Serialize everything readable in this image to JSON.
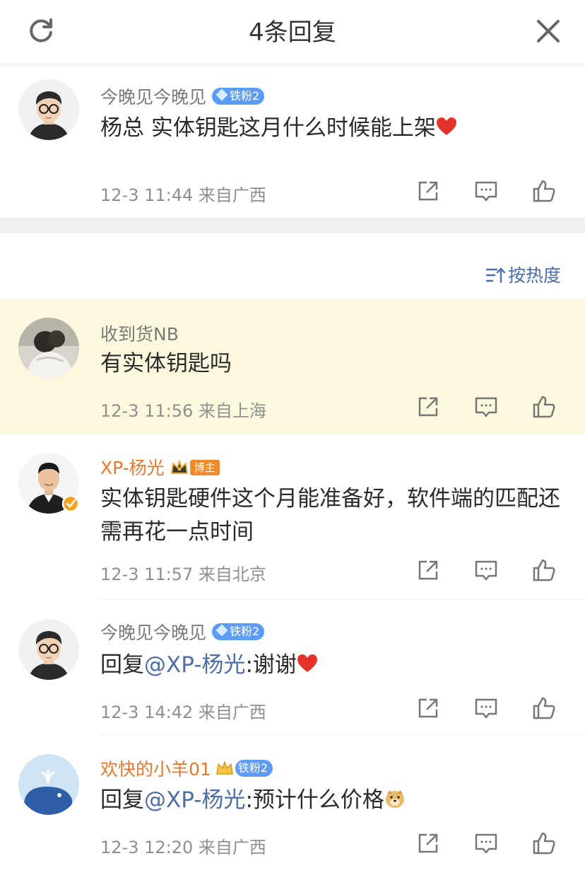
{
  "header": {
    "title": "4条回复",
    "refresh_icon": "refresh-icon",
    "close_icon": "close-icon"
  },
  "root_comment": {
    "username": "今晚见今晚见",
    "badge": "铁粉2",
    "text": "杨总 实体钥匙这月什么时候能上架",
    "time": "12-3 11:44",
    "location": "来自广西"
  },
  "sort": {
    "label": "按热度",
    "icon": "sort-icon"
  },
  "replies": [
    {
      "username": "收到货NB",
      "text": "有实体钥匙吗",
      "time": "12-3 11:56",
      "location": "来自上海",
      "highlighted": true
    },
    {
      "username": "XP-杨光",
      "badge": "博主",
      "text": "实体钥匙硬件这个月能准备好，软件端的匹配还需再花一点时间",
      "time": "12-3 11:57",
      "location": "来自北京"
    },
    {
      "username": "今晚见今晚见",
      "badge": "铁粉2",
      "reply_prefix": "回复",
      "mention": "@XP-杨光",
      "text": ":谢谢",
      "time": "12-3 14:42",
      "location": "来自广西"
    },
    {
      "username": "欢快的小羊01",
      "badge": "铁粉2",
      "reply_prefix": "回复",
      "mention": "@XP-杨光",
      "text": ":预计什么价格",
      "time": "12-3 12:20",
      "location": "来自广西"
    }
  ],
  "colors": {
    "accent_blue": "#4e6ea8",
    "vip_orange": "#e8792c",
    "highlight_bg": "#fcf8dd",
    "badge_blue": "#5d9cf5"
  }
}
